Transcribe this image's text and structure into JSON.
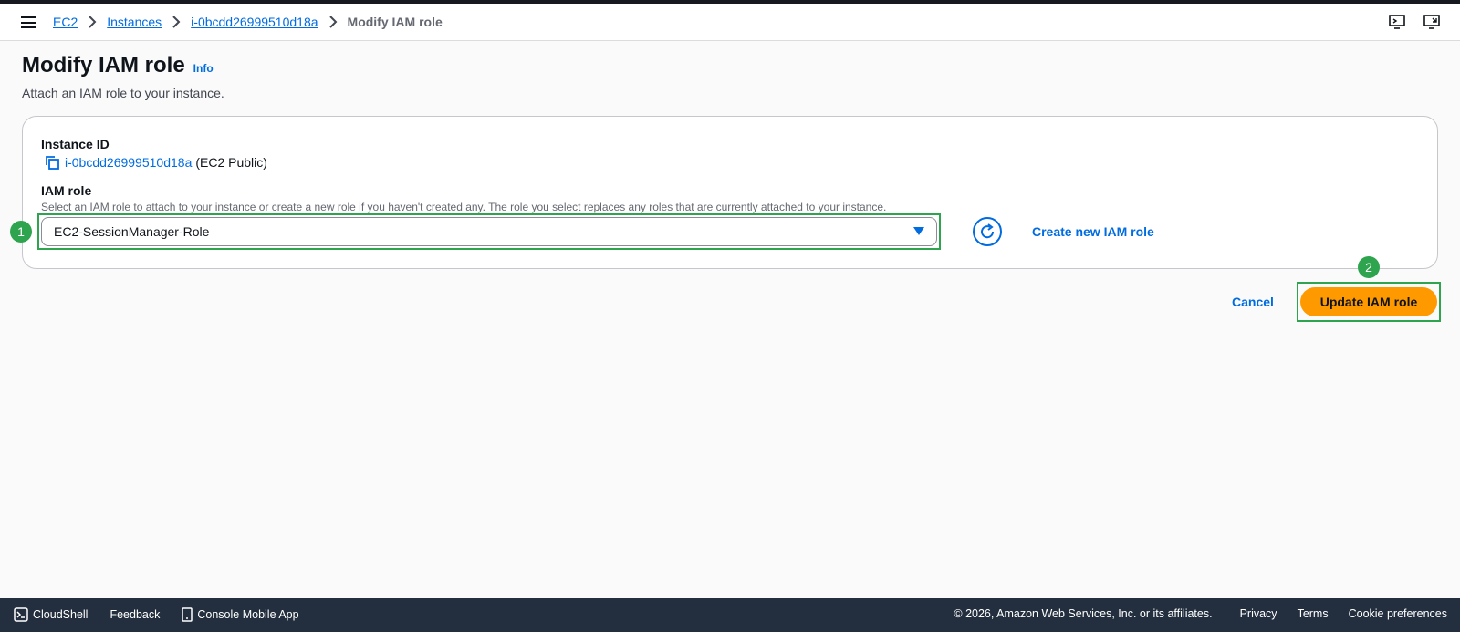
{
  "breadcrumb": {
    "items": [
      "EC2",
      "Instances",
      "i-0bcdd26999510d18a"
    ],
    "current": "Modify IAM role"
  },
  "header": {
    "title": "Modify IAM role",
    "info_label": "Info",
    "description": "Attach an IAM role to your instance."
  },
  "form": {
    "instance_id_label": "Instance ID",
    "instance_id_value": "i-0bcdd26999510d18a",
    "instance_id_suffix": "(EC2 Public)",
    "iam_role_label": "IAM role",
    "iam_role_description": "Select an IAM role to attach to your instance or create a new role if you haven't created any. The role you select replaces any roles that are currently attached to your instance.",
    "iam_role_selected": "EC2-SessionManager-Role",
    "create_role_label": "Create new IAM role"
  },
  "annotations": {
    "step1": "1",
    "step2": "2",
    "color": "#2ea44f"
  },
  "actions": {
    "cancel_label": "Cancel",
    "submit_label": "Update IAM role"
  },
  "footer": {
    "cloudshell_label": "CloudShell",
    "feedback_label": "Feedback",
    "mobile_app_label": "Console Mobile App",
    "copyright": "© 2026, Amazon Web Services, Inc. or its affiliates.",
    "privacy_label": "Privacy",
    "terms_label": "Terms",
    "cookie_label": "Cookie preferences"
  },
  "colors": {
    "link": "#006ce0",
    "primary": "#ff9900",
    "footer_bg": "#232f3e"
  },
  "icons": [
    "menu-icon",
    "chevron-right-icon",
    "help-panel-icon",
    "notifications-panel-icon",
    "copy-icon",
    "caret-down-icon",
    "refresh-icon",
    "cloudshell-icon",
    "mobile-icon"
  ]
}
